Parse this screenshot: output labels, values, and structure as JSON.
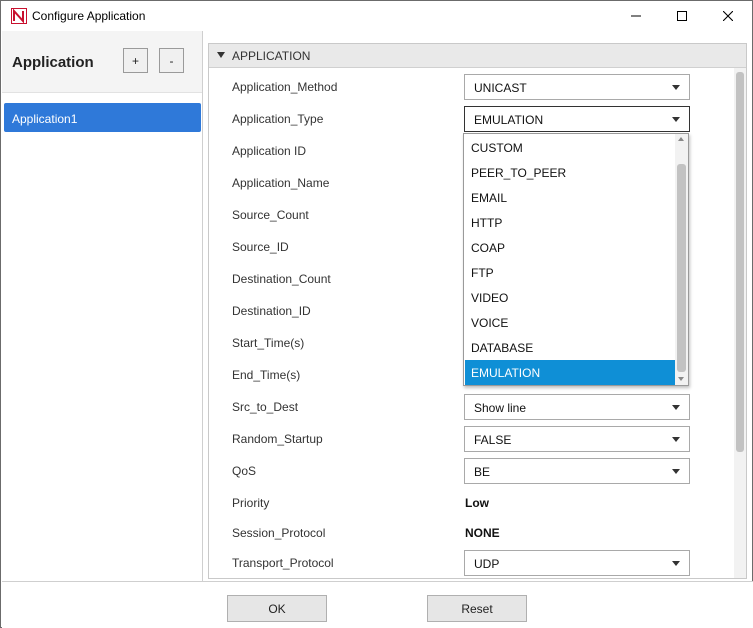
{
  "window": {
    "title": "Configure Application",
    "logo_letter": "N"
  },
  "left_panel": {
    "title": "Application",
    "add_label": "+",
    "remove_label": "-",
    "items": [
      {
        "label": "Application1",
        "selected": true
      }
    ]
  },
  "section": {
    "title": "APPLICATION"
  },
  "properties": [
    {
      "label": "Application_Method",
      "kind": "combo",
      "value": "UNICAST"
    },
    {
      "label": "Application_Type",
      "kind": "combo",
      "value": "EMULATION"
    },
    {
      "label": "Application ID",
      "kind": "hidden",
      "value": ""
    },
    {
      "label": "Application_Name",
      "kind": "hidden",
      "value": ""
    },
    {
      "label": "Source_Count",
      "kind": "hidden",
      "value": ""
    },
    {
      "label": "Source_ID",
      "kind": "hidden",
      "value": ""
    },
    {
      "label": "Destination_Count",
      "kind": "hidden",
      "value": ""
    },
    {
      "label": "Destination_ID",
      "kind": "hidden",
      "value": ""
    },
    {
      "label": "Start_Time(s)",
      "kind": "hidden",
      "value": ""
    },
    {
      "label": "End_Time(s)",
      "kind": "hidden",
      "value": ""
    },
    {
      "label": "Src_to_Dest",
      "kind": "combo",
      "value": "Show line"
    },
    {
      "label": "Random_Startup",
      "kind": "combo",
      "value": "FALSE"
    },
    {
      "label": "QoS",
      "kind": "combo",
      "value": "BE"
    },
    {
      "label": "Priority",
      "kind": "text",
      "value": "Low"
    },
    {
      "label": "Session_Protocol",
      "kind": "text",
      "value": "NONE"
    },
    {
      "label": "Transport_Protocol",
      "kind": "combo",
      "value": "UDP"
    }
  ],
  "dropdown": {
    "options": [
      "CUSTOM",
      "PEER_TO_PEER",
      "EMAIL",
      "HTTP",
      "COAP",
      "FTP",
      "VIDEO",
      "VOICE",
      "DATABASE",
      "EMULATION"
    ],
    "selected": "EMULATION"
  },
  "footer": {
    "ok_label": "OK",
    "reset_label": "Reset"
  },
  "colors": {
    "selection_blue": "#2f79d9",
    "dropdown_highlight": "#0f8fd6"
  }
}
